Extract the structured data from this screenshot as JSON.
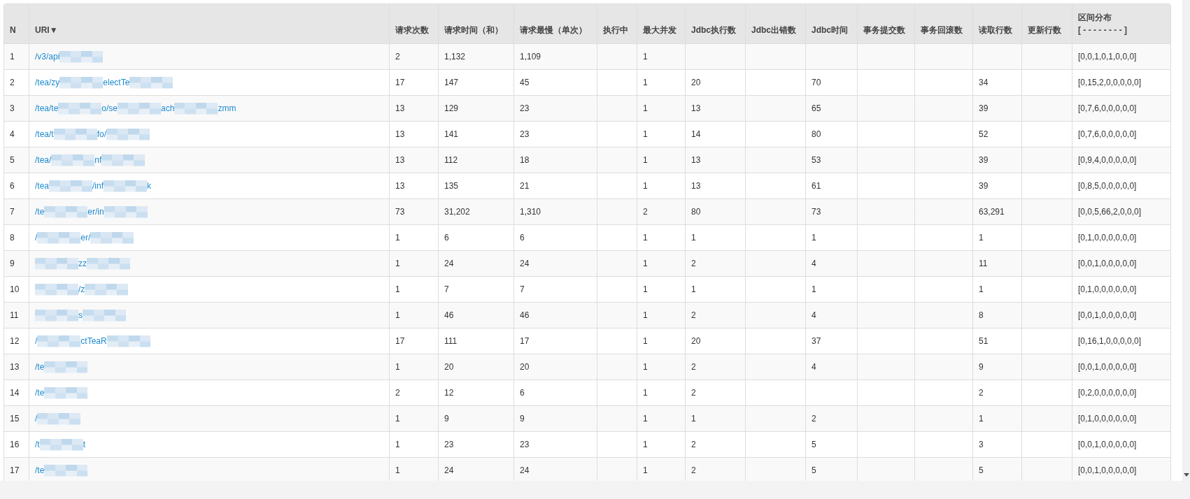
{
  "table": {
    "columns": [
      "N",
      "URI▼",
      "请求次数",
      "请求时间（和）",
      "请求最慢（单次）",
      "执行中",
      "最大并发",
      "Jdbc执行数",
      "Jdbc出错数",
      "Jdbc时间",
      "事务提交数",
      "事务回滚数",
      "读取行数",
      "更新行数",
      [
        "区间分布",
        "[ - - - - - - - - ]"
      ]
    ],
    "rows": [
      {
        "cells": [
          "1",
          {
            "uri": [
              {
                "kind": "text",
                "text": "/v3/api"
              },
              {
                "kind": "redacted"
              }
            ]
          },
          "2",
          "1,132",
          "1,109",
          "",
          "1",
          "",
          "",
          "",
          "",
          "",
          "",
          "",
          "[0,0,1,0,1,0,0,0]"
        ]
      },
      {
        "cells": [
          "2",
          {
            "uri": [
              {
                "kind": "text",
                "text": "/tea/zy"
              },
              {
                "kind": "redacted"
              },
              {
                "kind": "text",
                "text": "electTe"
              },
              {
                "kind": "redacted"
              }
            ]
          },
          "17",
          "147",
          "45",
          "",
          "1",
          "20",
          "",
          "70",
          "",
          "",
          "34",
          "",
          "[0,15,2,0,0,0,0,0]"
        ]
      },
      {
        "cells": [
          "3",
          {
            "uri": [
              {
                "kind": "text",
                "text": "/tea/te"
              },
              {
                "kind": "redacted"
              },
              {
                "kind": "text",
                "text": "o/se"
              },
              {
                "kind": "redacted"
              },
              {
                "kind": "text",
                "text": "ach"
              },
              {
                "kind": "redacted"
              },
              {
                "kind": "text",
                "text": "zmm"
              }
            ]
          },
          "13",
          "129",
          "23",
          "",
          "1",
          "13",
          "",
          "65",
          "",
          "",
          "39",
          "",
          "[0,7,6,0,0,0,0,0]"
        ]
      },
      {
        "cells": [
          "4",
          {
            "uri": [
              {
                "kind": "text",
                "text": "/tea/t"
              },
              {
                "kind": "redacted"
              },
              {
                "kind": "text",
                "text": "fo/"
              },
              {
                "kind": "redacted"
              }
            ]
          },
          "13",
          "141",
          "23",
          "",
          "1",
          "14",
          "",
          "80",
          "",
          "",
          "52",
          "",
          "[0,7,6,0,0,0,0,0]"
        ]
      },
      {
        "cells": [
          "5",
          {
            "uri": [
              {
                "kind": "text",
                "text": "/tea/"
              },
              {
                "kind": "redacted"
              },
              {
                "kind": "text",
                "text": "nf"
              },
              {
                "kind": "redacted"
              }
            ]
          },
          "13",
          "112",
          "18",
          "",
          "1",
          "13",
          "",
          "53",
          "",
          "",
          "39",
          "",
          "[0,9,4,0,0,0,0,0]"
        ]
      },
      {
        "cells": [
          "6",
          {
            "uri": [
              {
                "kind": "text",
                "text": "/tea"
              },
              {
                "kind": "redacted"
              },
              {
                "kind": "text",
                "text": "/inf"
              },
              {
                "kind": "redacted"
              },
              {
                "kind": "text",
                "text": "k"
              }
            ]
          },
          "13",
          "135",
          "21",
          "",
          "1",
          "13",
          "",
          "61",
          "",
          "",
          "39",
          "",
          "[0,8,5,0,0,0,0,0]"
        ]
      },
      {
        "cells": [
          "7",
          {
            "uri": [
              {
                "kind": "text",
                "text": "/te"
              },
              {
                "kind": "redacted"
              },
              {
                "kind": "text",
                "text": "er/in"
              },
              {
                "kind": "redacted"
              }
            ]
          },
          "73",
          "31,202",
          "1,310",
          "",
          "2",
          "80",
          "",
          "73",
          "",
          "",
          "63,291",
          "",
          "[0,0,5,66,2,0,0,0]"
        ]
      },
      {
        "cells": [
          "8",
          {
            "uri": [
              {
                "kind": "text",
                "text": "/"
              },
              {
                "kind": "redacted"
              },
              {
                "kind": "text",
                "text": "er/"
              },
              {
                "kind": "redacted"
              }
            ]
          },
          "1",
          "6",
          "6",
          "",
          "1",
          "1",
          "",
          "1",
          "",
          "",
          "1",
          "",
          "[0,1,0,0,0,0,0,0]"
        ]
      },
      {
        "cells": [
          "9",
          {
            "uri": [
              {
                "kind": "redacted"
              },
              {
                "kind": "text",
                "text": "zz"
              },
              {
                "kind": "redacted"
              }
            ]
          },
          "1",
          "24",
          "24",
          "",
          "1",
          "2",
          "",
          "4",
          "",
          "",
          "11",
          "",
          "[0,0,1,0,0,0,0,0]"
        ]
      },
      {
        "cells": [
          "10",
          {
            "uri": [
              {
                "kind": "redacted"
              },
              {
                "kind": "text",
                "text": "/z"
              },
              {
                "kind": "redacted"
              }
            ]
          },
          "1",
          "7",
          "7",
          "",
          "1",
          "1",
          "",
          "1",
          "",
          "",
          "1",
          "",
          "[0,1,0,0,0,0,0,0]"
        ]
      },
      {
        "cells": [
          "11",
          {
            "uri": [
              {
                "kind": "redacted"
              },
              {
                "kind": "text",
                "text": "s"
              },
              {
                "kind": "redacted"
              }
            ]
          },
          "1",
          "46",
          "46",
          "",
          "1",
          "2",
          "",
          "4",
          "",
          "",
          "8",
          "",
          "[0,0,1,0,0,0,0,0]"
        ]
      },
      {
        "cells": [
          "12",
          {
            "uri": [
              {
                "kind": "text",
                "text": "/"
              },
              {
                "kind": "redacted"
              },
              {
                "kind": "text",
                "text": "ctTeaR"
              },
              {
                "kind": "redacted"
              }
            ]
          },
          "17",
          "111",
          "17",
          "",
          "1",
          "20",
          "",
          "37",
          "",
          "",
          "51",
          "",
          "[0,16,1,0,0,0,0,0]"
        ]
      },
      {
        "cells": [
          "13",
          {
            "uri": [
              {
                "kind": "text",
                "text": "/te"
              },
              {
                "kind": "redacted"
              }
            ]
          },
          "1",
          "20",
          "20",
          "",
          "1",
          "2",
          "",
          "4",
          "",
          "",
          "9",
          "",
          "[0,0,1,0,0,0,0,0]"
        ]
      },
      {
        "cells": [
          "14",
          {
            "uri": [
              {
                "kind": "text",
                "text": "/te"
              },
              {
                "kind": "redacted"
              }
            ]
          },
          "2",
          "12",
          "6",
          "",
          "1",
          "2",
          "",
          "",
          "",
          "",
          "2",
          "",
          "[0,2,0,0,0,0,0,0]"
        ]
      },
      {
        "cells": [
          "15",
          {
            "uri": [
              {
                "kind": "text",
                "text": "/"
              },
              {
                "kind": "redacted"
              }
            ]
          },
          "1",
          "9",
          "9",
          "",
          "1",
          "1",
          "",
          "2",
          "",
          "",
          "1",
          "",
          "[0,1,0,0,0,0,0,0]"
        ]
      },
      {
        "cells": [
          "16",
          {
            "uri": [
              {
                "kind": "text",
                "text": "/t"
              },
              {
                "kind": "redacted"
              },
              {
                "kind": "text",
                "text": "t"
              }
            ]
          },
          "1",
          "23",
          "23",
          "",
          "1",
          "2",
          "",
          "5",
          "",
          "",
          "3",
          "",
          "[0,0,1,0,0,0,0,0]"
        ]
      },
      {
        "cells": [
          "17",
          {
            "uri": [
              {
                "kind": "text",
                "text": "/te"
              },
              {
                "kind": "redacted"
              }
            ]
          },
          "1",
          "24",
          "24",
          "",
          "1",
          "2",
          "",
          "5",
          "",
          "",
          "5",
          "",
          "[0,0,1,0,0,0,0,0]"
        ]
      }
    ]
  }
}
